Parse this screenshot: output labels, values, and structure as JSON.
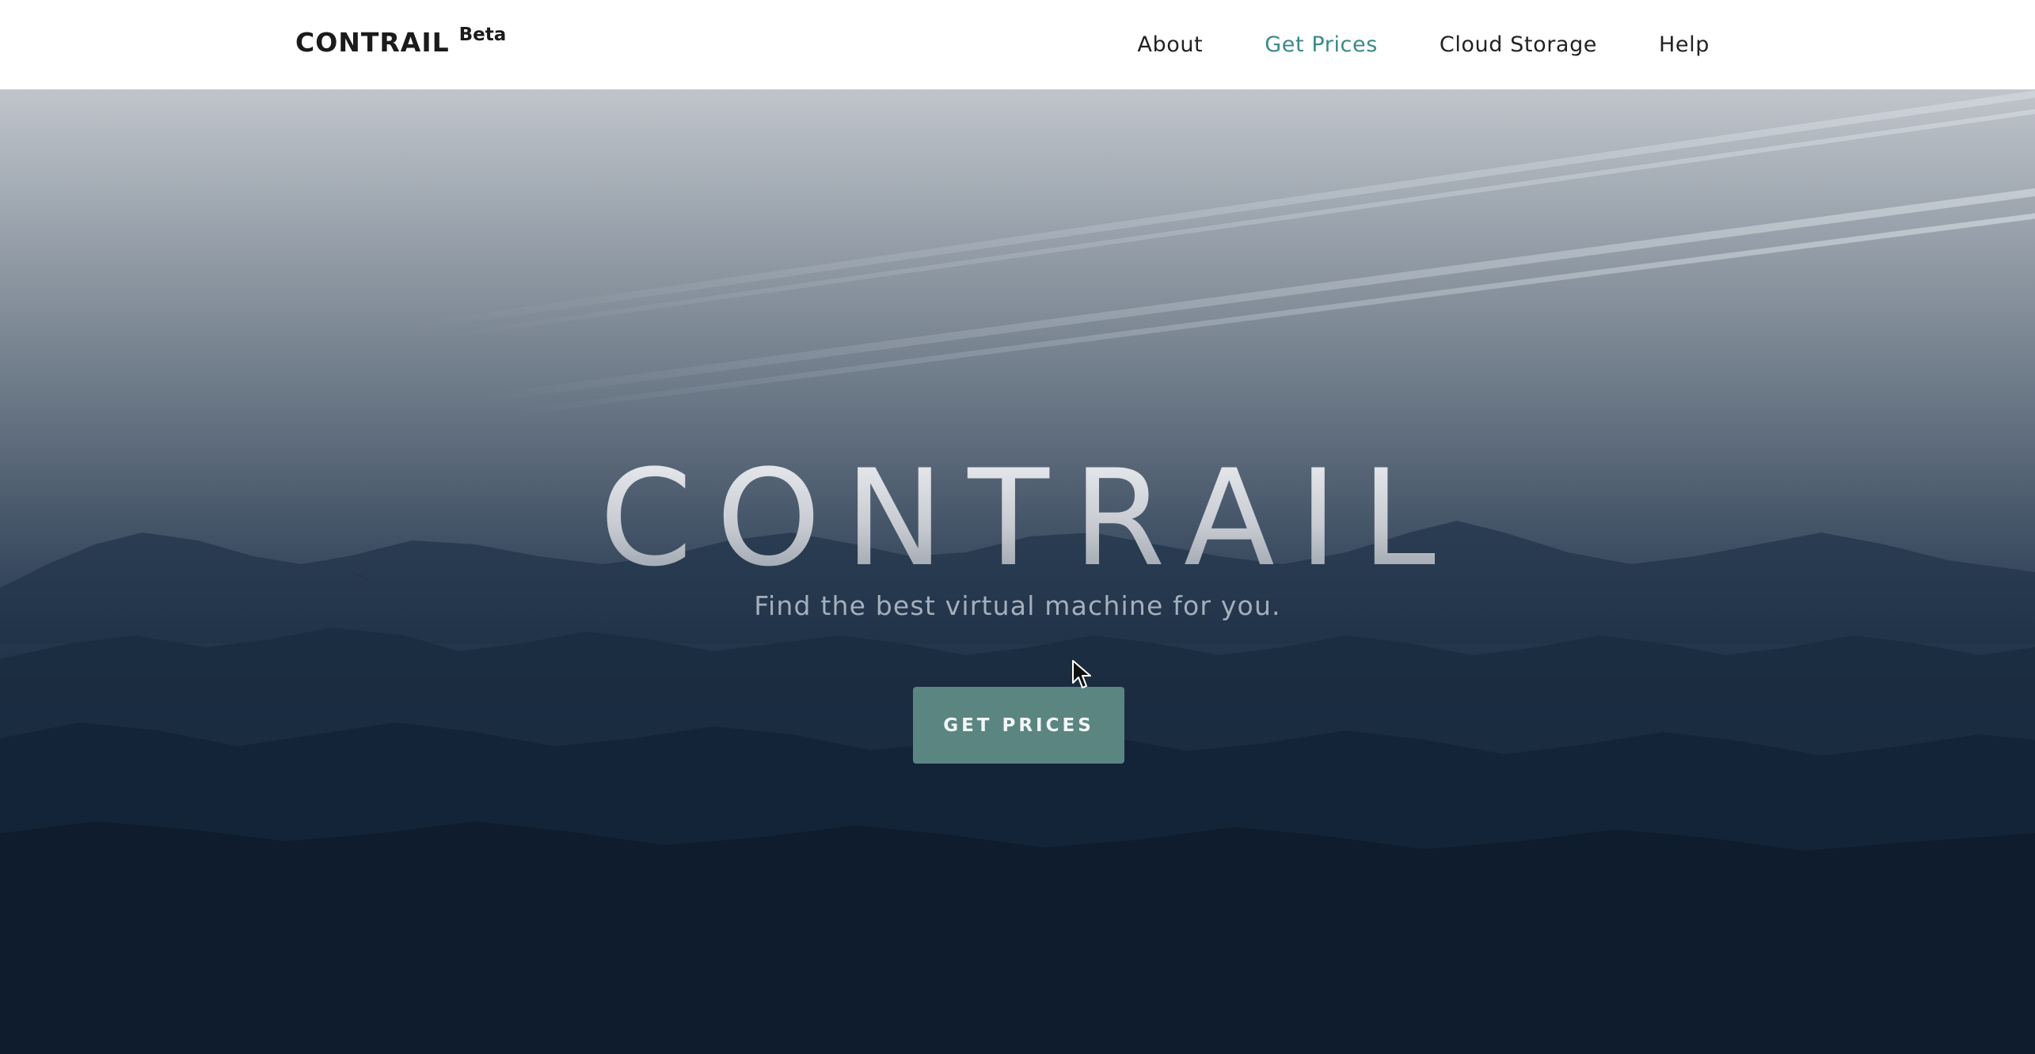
{
  "navbar": {
    "brand": "CONTRAIL",
    "brand_badge": "Beta",
    "links": [
      {
        "label": "About",
        "active": false
      },
      {
        "label": "Get Prices",
        "active": true
      },
      {
        "label": "Cloud Storage",
        "active": false
      },
      {
        "label": "Help",
        "active": false
      }
    ]
  },
  "hero": {
    "title": "CONTRAIL",
    "subtitle": "Find the best virtual machine for you.",
    "cta_label": "GET PRICES"
  },
  "colors": {
    "accent": "#3a8a86",
    "cta_background": "#5b8581",
    "navbar_background": "#ffffff",
    "hero_top": "#c0c5cb",
    "hero_bottom": "#0c1726"
  },
  "icons": {
    "cursor": "mouse-pointer-icon"
  }
}
